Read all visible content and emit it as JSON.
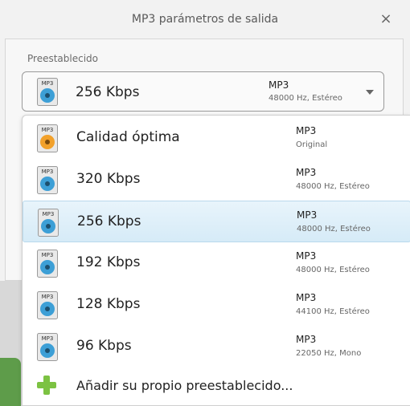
{
  "window": {
    "title": "MP3 parámetros de salida",
    "close_glyph": "×"
  },
  "preset": {
    "label": "Preestablecido",
    "selected": {
      "label": "256 Kbps",
      "format": "MP3",
      "details": "48000 Hz,  Estéreo",
      "icon": "mp3-blue-icon"
    }
  },
  "dropdown": {
    "items": [
      {
        "label": "Calidad óptima",
        "format": "MP3",
        "details": "Original",
        "icon": "mp3-orange-icon"
      },
      {
        "label": "320 Kbps",
        "format": "MP3",
        "details": "48000 Hz,  Estéreo",
        "icon": "mp3-blue-icon"
      },
      {
        "label": "256 Kbps",
        "format": "MP3",
        "details": "48000 Hz,  Estéreo",
        "icon": "mp3-blue-icon",
        "selected": true
      },
      {
        "label": "192 Kbps",
        "format": "MP3",
        "details": "48000 Hz,  Estéreo",
        "icon": "mp3-blue-icon"
      },
      {
        "label": "128 Kbps",
        "format": "MP3",
        "details": "44100 Hz,  Estéreo",
        "icon": "mp3-blue-icon"
      },
      {
        "label": "96 Kbps",
        "format": "MP3",
        "details": "22050 Hz,  Mono",
        "icon": "mp3-blue-icon"
      }
    ],
    "add_label": "Añadir su propio preestablecido..."
  },
  "icon_text": "MP3",
  "colors": {
    "disc_blue": "#3d9fd6",
    "disc_orange": "#f2a12b",
    "accent_green": "#7cc242",
    "selection": "#d6ebf7"
  }
}
